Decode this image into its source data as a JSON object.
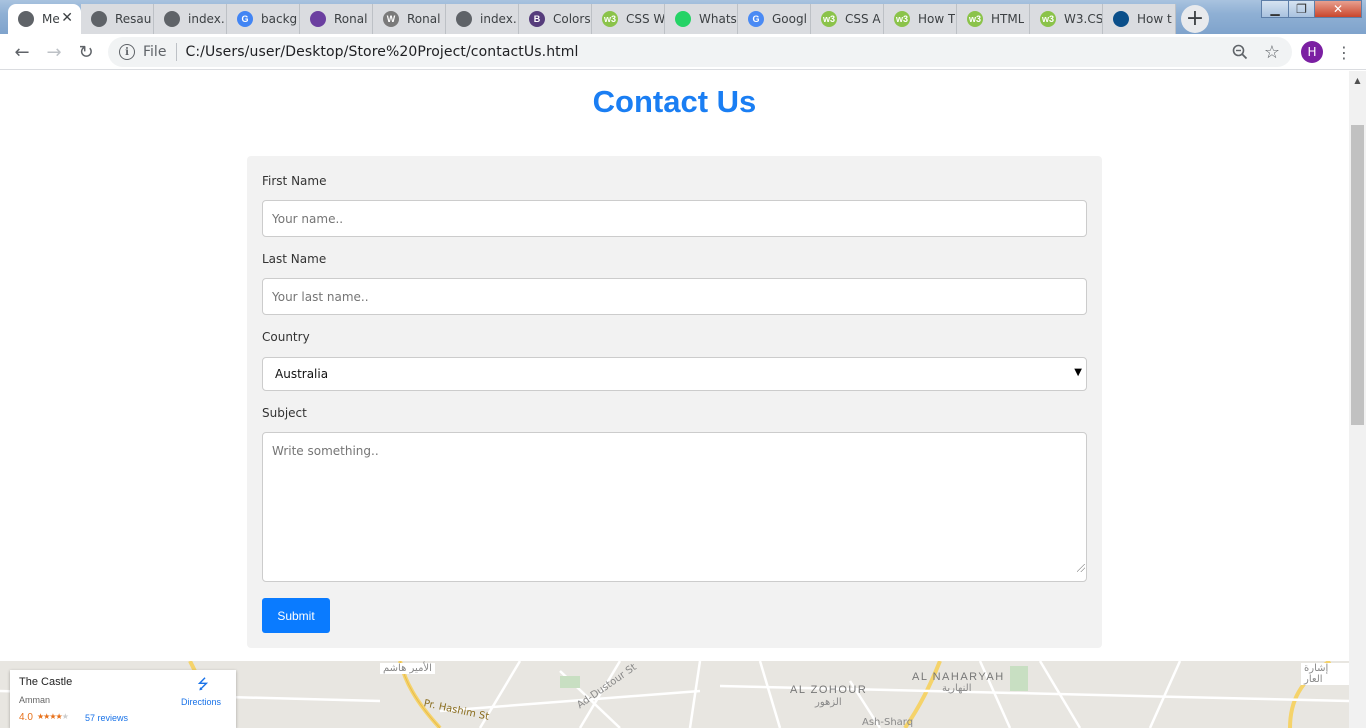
{
  "browser": {
    "tabs": [
      {
        "title": "Me",
        "icon": "globe-icon",
        "fav_bg": "#5f6368",
        "fav_text": "",
        "active": true
      },
      {
        "title": "Resau",
        "icon": "globe-icon",
        "fav_bg": "#5f6368",
        "fav_text": "",
        "active": false
      },
      {
        "title": "index.",
        "icon": "globe-icon",
        "fav_bg": "#5f6368",
        "fav_text": "",
        "active": false
      },
      {
        "title": "backg",
        "icon": "google-icon",
        "fav_bg": "#4285f4",
        "fav_text": "G",
        "active": false
      },
      {
        "title": "Ronal",
        "icon": "colorlib-icon",
        "fav_bg": "#6b3fa0",
        "fav_text": "",
        "active": false
      },
      {
        "title": "Ronal",
        "icon": "wordpress-icon",
        "fav_bg": "#7a7a7a",
        "fav_text": "W",
        "active": false
      },
      {
        "title": "index.",
        "icon": "globe-icon",
        "fav_bg": "#5f6368",
        "fav_text": "",
        "active": false
      },
      {
        "title": "Colors",
        "icon": "bootstrap-icon",
        "fav_bg": "#563d7c",
        "fav_text": "B",
        "active": false
      },
      {
        "title": "CSS W",
        "icon": "w3schools-icon",
        "fav_bg": "#8bc34a",
        "fav_text": "w3",
        "active": false
      },
      {
        "title": "Whats",
        "icon": "whatsapp-icon",
        "fav_bg": "#25d366",
        "fav_text": "",
        "active": false
      },
      {
        "title": "Googl",
        "icon": "google-translate-icon",
        "fav_bg": "#4a8af4",
        "fav_text": "G",
        "active": false
      },
      {
        "title": "CSS A",
        "icon": "w3schools-icon",
        "fav_bg": "#8bc34a",
        "fav_text": "w3",
        "active": false
      },
      {
        "title": "How T",
        "icon": "w3schools-icon",
        "fav_bg": "#8bc34a",
        "fav_text": "w3",
        "active": false
      },
      {
        "title": "HTML",
        "icon": "w3schools-icon",
        "fav_bg": "#8bc34a",
        "fav_text": "w3",
        "active": false
      },
      {
        "title": "W3.CS",
        "icon": "w3schools-icon",
        "fav_bg": "#8bc34a",
        "fav_text": "w3",
        "active": false
      },
      {
        "title": "How t",
        "icon": "site-icon",
        "fav_bg": "#0b4f8a",
        "fav_text": "",
        "active": false
      }
    ],
    "new_tab": "+",
    "address": {
      "scheme_label": "File",
      "url": "C:/Users/user/Desktop/Store%20Project/contactUs.html"
    },
    "avatar_letter": "H",
    "colors": {
      "avatar": "#7b1fa2",
      "accent": "#1a73e8"
    }
  },
  "page": {
    "title": "Contact Us",
    "title_color": "#1a7ef3",
    "form": {
      "first_name_label": "First Name",
      "first_name_placeholder": "Your name..",
      "last_name_label": "Last Name",
      "last_name_placeholder": "Your last name..",
      "country_label": "Country",
      "country_value": "Australia",
      "subject_label": "Subject",
      "subject_placeholder": "Write something..",
      "submit_label": "Submit",
      "submit_color": "#0a7bff"
    }
  },
  "map": {
    "place": {
      "name": "The Castle",
      "city": "Amman",
      "rating": "4.0",
      "stars": 4,
      "reviews": "57 reviews",
      "directions_label": "Directions"
    },
    "labels": {
      "district1": "AL ZOHOUR",
      "district1_ar": "الزهور",
      "district2": "AL NAHARYAH",
      "district2_ar": "النهارية",
      "street1": "Pr. Hashim St",
      "street2": "Ad-Dustour St",
      "street3": "Ash-Sharq",
      "poi1": "الأمير هاشم",
      "poi2": "إشارة العار"
    }
  }
}
